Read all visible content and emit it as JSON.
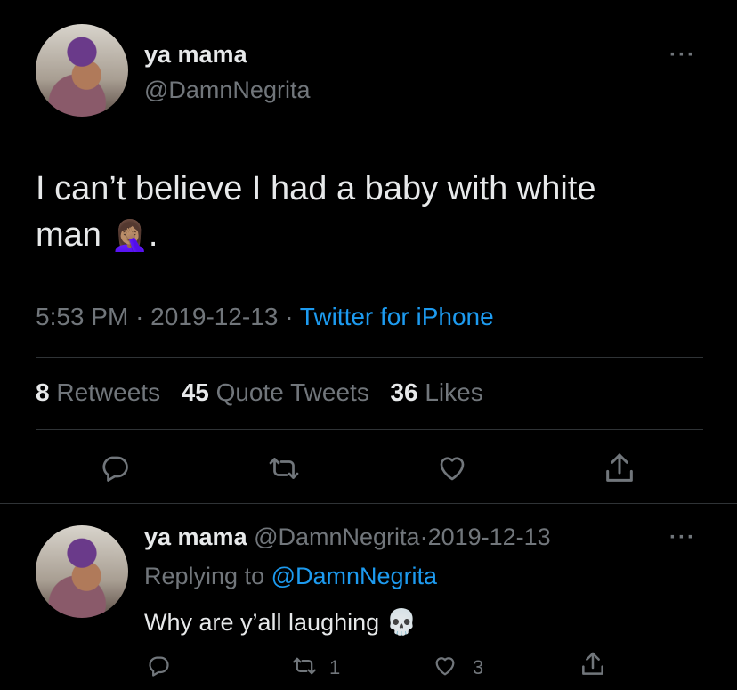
{
  "main_tweet": {
    "display_name": "ya mama",
    "handle": "@DamnNegrita",
    "more_label": "···",
    "text_line1": "I can’t believe I had a baby with white",
    "text_line2": "man",
    "text_emoji": "🤦🏽‍♀️",
    "text_end": ".",
    "time": "5:53 PM",
    "sep1": "·",
    "date": "2019-12-13",
    "sep2": "·",
    "source": "Twitter for iPhone",
    "stats": {
      "retweets_count": "8",
      "retweets_label": "Retweets",
      "quotes_count": "45",
      "quotes_label": "Quote Tweets",
      "likes_count": "36",
      "likes_label": "Likes"
    }
  },
  "reply": {
    "display_name": "ya mama",
    "handle": "@DamnNegrita",
    "sep": "·",
    "date": "2019-12-13",
    "more_label": "···",
    "replying_prefix": "Replying to",
    "replying_handle": "@DamnNegrita",
    "text": "Why are y’all laughing",
    "text_emoji": "💀",
    "retweet_count": "1",
    "like_count": "3"
  },
  "colors": {
    "background": "#000000",
    "text": "#e7e9ea",
    "muted": "#71767b",
    "link": "#1d9bf0",
    "divider": "#2f3336"
  },
  "icons": [
    "reply-icon",
    "retweet-icon",
    "like-icon",
    "share-icon",
    "more-icon"
  ]
}
